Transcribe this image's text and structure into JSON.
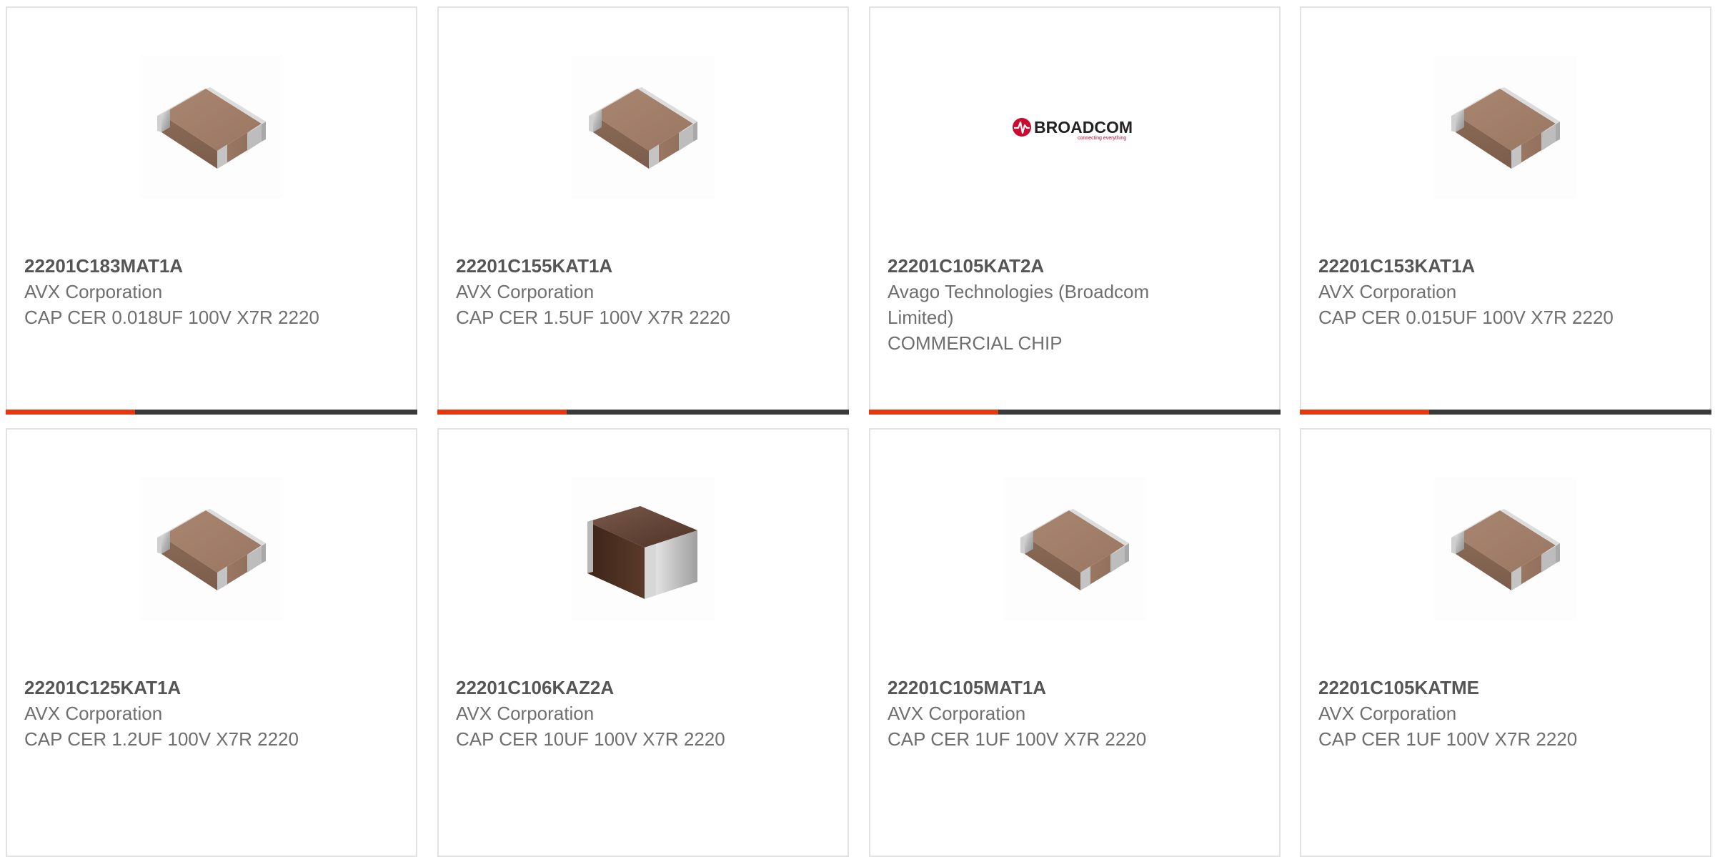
{
  "colors": {
    "accent": "#e8360e",
    "bar_dark": "#3a3a3a",
    "part_text": "#555555",
    "body_text": "#6f6f6f",
    "card_border": "#e2e2e2",
    "broadcom_red": "#cc092f"
  },
  "products": [
    {
      "part": "22201C183MAT1A",
      "manufacturer": "AVX Corporation",
      "description": "CAP CER 0.018UF 100V X7R 2220",
      "image": "capacitor-chip-icon"
    },
    {
      "part": "22201C155KAT1A",
      "manufacturer": "AVX Corporation",
      "description": "CAP CER 1.5UF 100V X7R 2220",
      "image": "capacitor-chip-icon"
    },
    {
      "part": "22201C105KAT2A",
      "manufacturer": "Avago Technologies (Broadcom Limited)",
      "description": "COMMERCIAL CHIP",
      "image": "broadcom-logo",
      "logo_text": "BROADCOM",
      "logo_tagline": "connecting everything"
    },
    {
      "part": "22201C153KAT1A",
      "manufacturer": "AVX Corporation",
      "description": "CAP CER 0.015UF 100V X7R 2220",
      "image": "capacitor-chip-icon"
    },
    {
      "part": "22201C125KAT1A",
      "manufacturer": "AVX Corporation",
      "description": "CAP CER 1.2UF 100V X7R 2220",
      "image": "capacitor-chip-icon"
    },
    {
      "part": "22201C106KAZ2A",
      "manufacturer": "AVX Corporation",
      "description": "CAP CER 10UF 100V X7R 2220",
      "image": "capacitor-chip-dark-icon"
    },
    {
      "part": "22201C105MAT1A",
      "manufacturer": "AVX Corporation",
      "description": "CAP CER 1UF 100V X7R 2220",
      "image": "capacitor-chip-icon"
    },
    {
      "part": "22201C105KATME",
      "manufacturer": "AVX Corporation",
      "description": "CAP CER 1UF 100V X7R 2220",
      "image": "capacitor-chip-icon"
    }
  ]
}
